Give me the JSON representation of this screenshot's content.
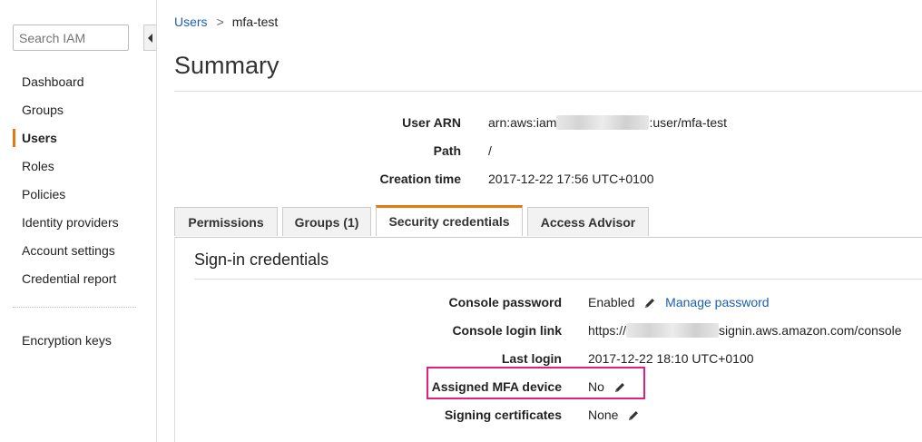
{
  "sidebar": {
    "search_placeholder": "Search IAM",
    "items": [
      {
        "label": "Dashboard"
      },
      {
        "label": "Groups"
      },
      {
        "label": "Users"
      },
      {
        "label": "Roles"
      },
      {
        "label": "Policies"
      },
      {
        "label": "Identity providers"
      },
      {
        "label": "Account settings"
      },
      {
        "label": "Credential report"
      }
    ],
    "bottom_items": [
      {
        "label": "Encryption keys"
      }
    ],
    "active_item": "Users"
  },
  "breadcrumb": {
    "parent": "Users",
    "separator": ">",
    "current": "mfa-test"
  },
  "page_title": "Summary",
  "summary": {
    "user_arn": {
      "label": "User ARN",
      "prefix": "arn:aws:iam",
      "suffix": ":user/mfa-test"
    },
    "path": {
      "label": "Path",
      "value": "/"
    },
    "creation_time": {
      "label": "Creation time",
      "value": "2017-12-22 17:56 UTC+0100"
    }
  },
  "tabs": [
    {
      "label": "Permissions"
    },
    {
      "label": "Groups (1)"
    },
    {
      "label": "Security credentials"
    },
    {
      "label": "Access Advisor"
    }
  ],
  "active_tab": "Security credentials",
  "signin": {
    "title": "Sign-in credentials",
    "console_password": {
      "label": "Console password",
      "value": "Enabled",
      "link": "Manage password"
    },
    "console_login_link": {
      "label": "Console login link",
      "prefix": "https://",
      "suffix": "signin.aws.amazon.com/console"
    },
    "last_login": {
      "label": "Last login",
      "value": "2017-12-22 18:10 UTC+0100"
    },
    "assigned_mfa": {
      "label": "Assigned MFA device",
      "value": "No"
    },
    "signing_certificates": {
      "label": "Signing certificates",
      "value": "None"
    }
  },
  "colors": {
    "accent": "#e47911",
    "link": "#1a5fb4",
    "highlight": "#e2207b"
  },
  "icons": {
    "edit": "pencil-icon",
    "collapse": "caret-left-icon",
    "breadcrumb_separator": "chevron-right-icon"
  }
}
